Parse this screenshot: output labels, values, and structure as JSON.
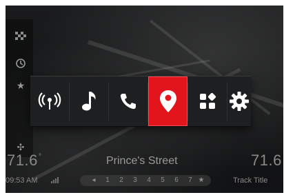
{
  "colors": {
    "accent": "#E2141C",
    "bg": "#141516",
    "text": "#9A9A9A",
    "tray": "#1E1F20"
  },
  "left_rail": {
    "icons": [
      "checkered-flag-icon",
      "history-icon",
      "star-icon",
      "move-icon"
    ]
  },
  "tray": {
    "tiles": [
      {
        "name": "radio-tile",
        "icon": "radio-antenna-icon",
        "active": false
      },
      {
        "name": "media-tile",
        "icon": "music-note-icon",
        "active": false
      },
      {
        "name": "phone-tile",
        "icon": "phone-icon",
        "active": false
      },
      {
        "name": "navigation-tile",
        "icon": "map-pin-icon",
        "active": true
      },
      {
        "name": "apps-tile",
        "icon": "grid-apps-icon",
        "active": false
      },
      {
        "name": "settings-tile",
        "icon": "gear-icon",
        "active": false
      }
    ]
  },
  "status": {
    "temp_left": "71.6",
    "temp_right": "71.6",
    "street": "Prince's Street",
    "time": "09:53 AM",
    "track_title": "Track Title"
  },
  "presets": {
    "left_glyph": "◂",
    "items": [
      "1",
      "2",
      "3",
      "4",
      "5",
      "6",
      "7"
    ],
    "right_glyph": "★"
  }
}
